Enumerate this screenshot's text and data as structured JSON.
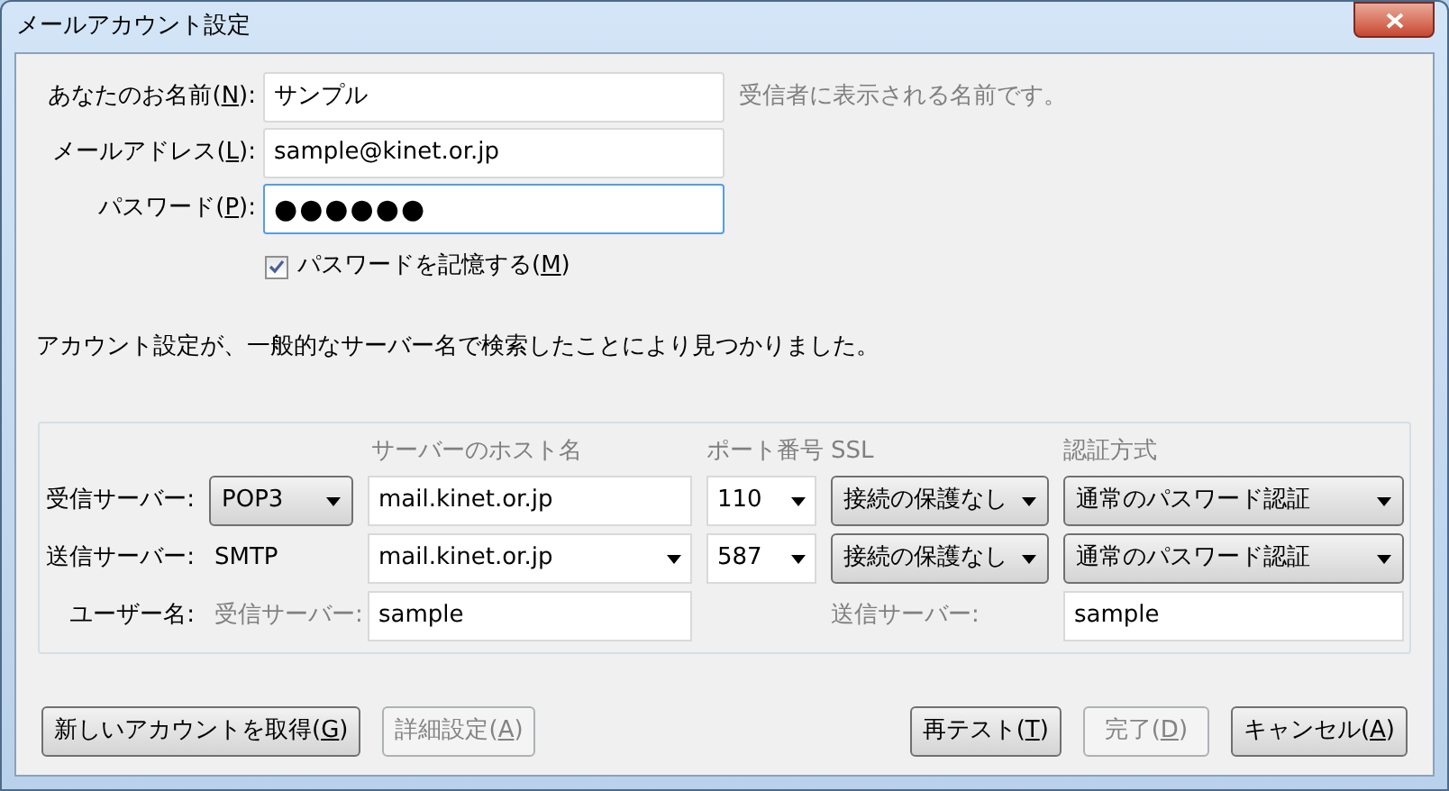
{
  "window": {
    "title": "メールアカウント設定"
  },
  "identity": [
    {
      "before": "あなたのお名前(",
      "key": "N",
      "after": "):",
      "value": "サンプル",
      "hint": "受信者に表示される名前です。",
      "focused": false
    },
    {
      "before": "メールアドレス(",
      "key": "L",
      "after": "):",
      "value": "sample@kinet.or.jp",
      "focused": false
    },
    {
      "before": "パスワード(",
      "key": "P",
      "after": "):",
      "value": "●●●●●●",
      "focused": true
    }
  ],
  "remember": {
    "before": "パスワードを記憶する(",
    "key": "M",
    "after": ")",
    "checked": true
  },
  "message": "アカウント設定が、一般的なサーバー名で検索したことにより見つかりました。",
  "servers": {
    "headers": [
      "サーバーのホスト名",
      "ポート番号",
      "SSL",
      "認証方式"
    ],
    "rows": [
      {
        "label": "受信サーバー:",
        "protocol": {
          "kind": "dropdown",
          "value": "POP3"
        },
        "host": {
          "value": "mail.kinet.or.jp",
          "dropdown": false
        },
        "port": "110",
        "ssl": "接続の保護なし",
        "auth": "通常のパスワード認証"
      },
      {
        "label": "送信サーバー:",
        "protocol": {
          "kind": "text",
          "value": "SMTP"
        },
        "host": {
          "value": "mail.kinet.or.jp",
          "dropdown": true
        },
        "port": "587",
        "ssl": "接続の保護なし",
        "auth": "通常のパスワード認証"
      }
    ],
    "username": {
      "label": "ユーザー名:",
      "incoming_label": "受信サーバー:",
      "incoming_value": "sample",
      "outgoing_label": "送信サーバー:",
      "outgoing_value": "sample"
    }
  },
  "buttons_left": [
    {
      "before": "新しいアカウントを取得(",
      "key": "G",
      "after": ")",
      "disabled": false
    },
    {
      "before": "詳細設定(",
      "key": "A",
      "after": ")",
      "disabled": true
    }
  ],
  "buttons_right": [
    {
      "before": "再テスト(",
      "key": "T",
      "after": ")",
      "disabled": false
    },
    {
      "before": "完了(",
      "key": "D",
      "after": ")",
      "disabled": true
    },
    {
      "before": "キャンセル(",
      "key": "A",
      "after": ")",
      "disabled": false
    }
  ]
}
